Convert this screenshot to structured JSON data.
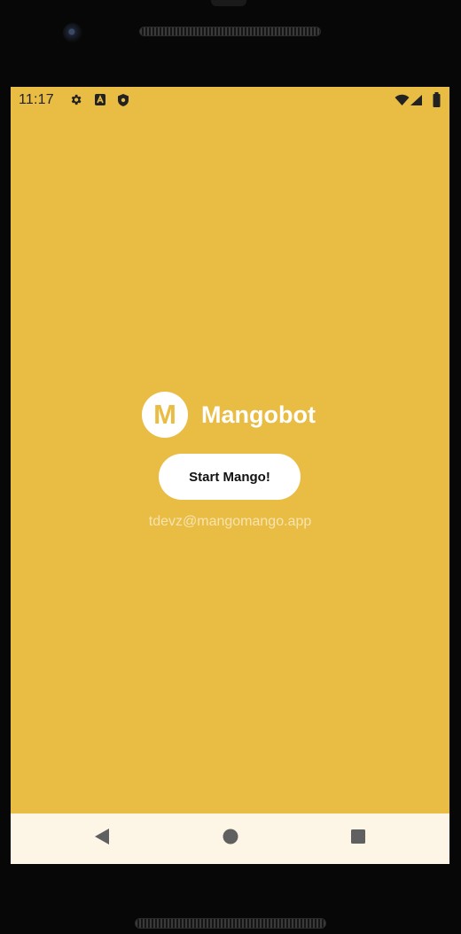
{
  "status_bar": {
    "time": "11:17",
    "icons": [
      "gear-icon",
      "a-badge-icon",
      "shield-icon",
      "wifi-icon",
      "signal-icon",
      "battery-icon"
    ]
  },
  "app": {
    "logo_letter": "M",
    "name": "Mangobot",
    "start_button_label": "Start Mango!",
    "email": "tdevz@mangomango.app"
  },
  "nav_bar": {
    "icons": [
      "back-icon",
      "home-icon",
      "recents-icon"
    ]
  },
  "colors": {
    "background": "#e9bc43",
    "nav_bar": "#fdf6e6",
    "button": "#ffffff",
    "text_white": "#ffffff",
    "email_text": "#f6e4b0"
  }
}
